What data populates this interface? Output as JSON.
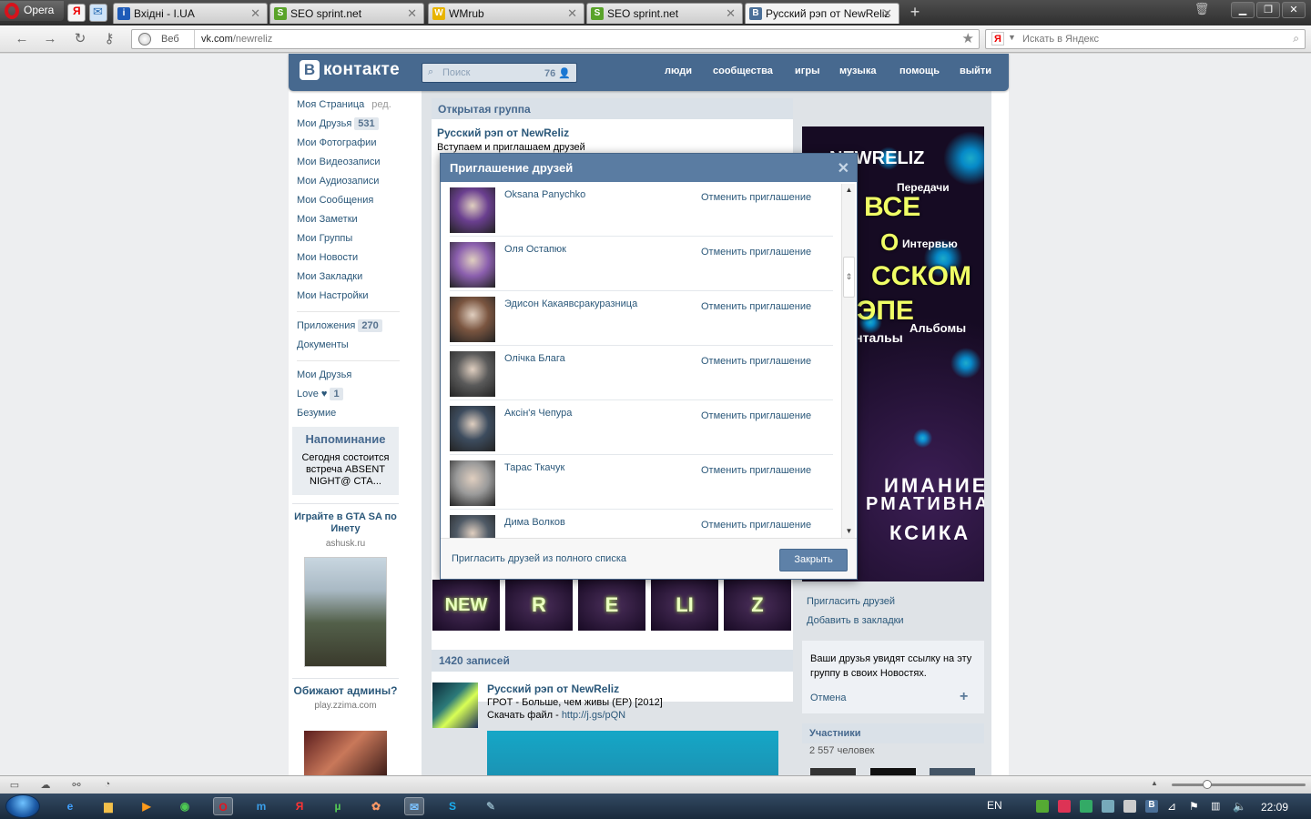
{
  "browser": {
    "menu_label": "Opera",
    "tabs": [
      {
        "label": "Вхідні - I.UA",
        "icon": "i-ua-icon",
        "color": "#1e5bb8",
        "glyph": "i"
      },
      {
        "label": "SEO sprint.net",
        "icon": "seosprint-icon",
        "color": "#59a329",
        "glyph": "S"
      },
      {
        "label": "WMrub",
        "icon": "wmrub-icon",
        "color": "#e8b400",
        "glyph": "W"
      },
      {
        "label": "SEO sprint.net",
        "icon": "seosprint-icon",
        "color": "#59a329",
        "glyph": "S"
      },
      {
        "label": "Русский рэп от NewReliz",
        "icon": "vk-icon",
        "color": "#4a6f98",
        "glyph": "B"
      }
    ],
    "address_prefix": "Веб",
    "url_host": "vk.com",
    "url_path": "/newreliz",
    "search_placeholder": "Искать в Яндекс",
    "search_logo": "Я"
  },
  "vk": {
    "logo_letter": "В",
    "logo_text": "контакте",
    "search_placeholder": "Поиск",
    "search_count": "76",
    "nav": [
      "люди",
      "сообщества",
      "игры",
      "музыка",
      "помощь",
      "выйти"
    ],
    "menu": [
      {
        "label": "Моя Страница",
        "edit": "ред."
      },
      {
        "label": "Мои Друзья",
        "badge": "531"
      },
      {
        "label": "Мои Фотографии"
      },
      {
        "label": "Мои Видеозаписи"
      },
      {
        "label": "Мои Аудиозаписи"
      },
      {
        "label": "Мои Сообщения"
      },
      {
        "label": "Мои Заметки"
      },
      {
        "label": "Мои Группы"
      },
      {
        "label": "Мои Новости"
      },
      {
        "label": "Мои Закладки"
      },
      {
        "label": "Мои Настройки"
      }
    ],
    "menu2": [
      {
        "label": "Приложения",
        "badge": "270"
      },
      {
        "label": "Документы"
      }
    ],
    "menu3": [
      {
        "label": "Мои Друзья"
      },
      {
        "label": "Love ♥",
        "badge": "1"
      },
      {
        "label": "Безумие"
      }
    ],
    "reminder": {
      "title": "Напоминание",
      "text": "Сегодня состоится встреча ABSENT NIGHT@ СТА..."
    },
    "ads": [
      {
        "title": "Играйте в GTA SA по Инету",
        "site": "ashusk.ru"
      },
      {
        "title": "Обижают админы?",
        "site": "play.zzima.com"
      }
    ],
    "group": {
      "type_label": "Открытая группа",
      "name": "Русский рэп от NewReliz",
      "status": "Вступаем и приглашаем друзей",
      "strip_letters": [
        "NEW",
        "R",
        "E",
        "LI",
        "Z"
      ],
      "wall_count": "1420 записей",
      "post": {
        "author": "Русский рэп от NewReliz",
        "line1": "ГРОТ - Больше, чем живы (EP) [2012]",
        "line2_prefix": "Скачать файл - ",
        "line2_link": "http://j.gs/pQN"
      },
      "poster_text": [
        "NEWRELIZ",
        "Передачи",
        "ВСЕ",
        "О",
        "Интервью",
        "ССКОМ",
        "ЭПЕ",
        "Альбомы",
        "ментальы",
        "ИМАНИЕ",
        "РМАТИВНАЯ",
        "КСИКА"
      ],
      "right_links": [
        "Пригласить друзей",
        "Добавить в закладки"
      ],
      "share_text": "Ваши друзья увидят ссылку на эту группу в своих Новостях.",
      "share_cancel": "Отмена",
      "share_plus": "+",
      "members_title": "Участники",
      "members_count": "2 557 человек"
    },
    "dialog": {
      "title": "Приглашение друзей",
      "close_glyph": "✕",
      "friends": [
        {
          "name": "Oksana Panychko",
          "action": "Отменить приглашение",
          "color": "#6a3f8f"
        },
        {
          "name": "Оля Остапюк",
          "action": "Отменить приглашение",
          "color": "#8b5fae"
        },
        {
          "name": "Эдисон Какаявсракуразница",
          "action": "Отменить приглашение",
          "color": "#7a5540"
        },
        {
          "name": "Олічка Блага",
          "action": "Отменить приглашение",
          "color": "#5a5a5a"
        },
        {
          "name": "Аксін'я Чепура",
          "action": "Отменить приглашение",
          "color": "#3d4c5e"
        },
        {
          "name": "Тарас Ткачук",
          "action": "Отменить приглашение",
          "color": "#9a9a9a"
        },
        {
          "name": "Дима Волков",
          "action": "Отменить приглашение",
          "color": "#4f5a66"
        }
      ],
      "footer_link": "Пригласить друзей из полного списка",
      "close_button": "Закрыть"
    }
  },
  "taskbar": {
    "lang": "EN",
    "clock": "22:09"
  }
}
